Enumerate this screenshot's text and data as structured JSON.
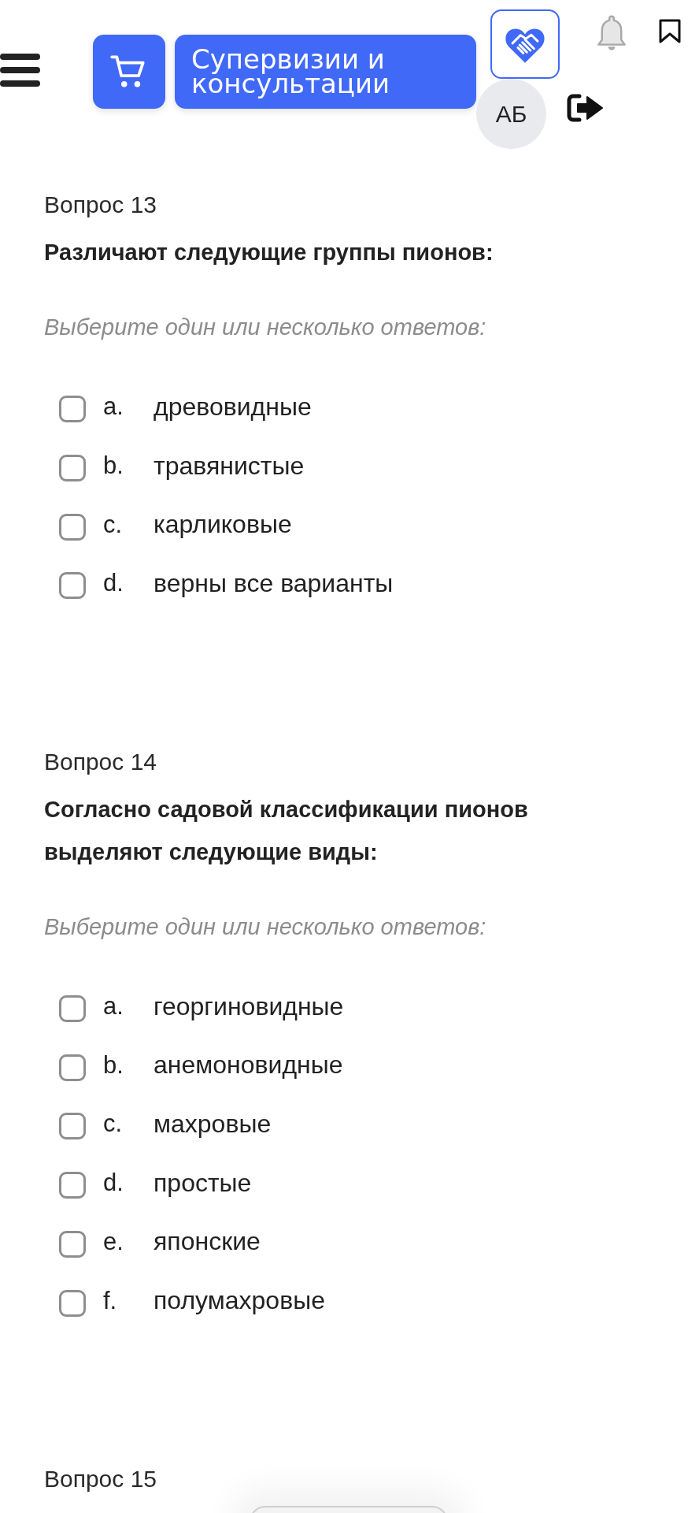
{
  "header": {
    "title_button": "Супервизии и консультации",
    "avatar_initials": "АБ"
  },
  "questions": [
    {
      "label": "Вопрос 13",
      "text": "Различают следующие группы пионов:",
      "hint": "Выберите один или несколько ответов:",
      "options": [
        {
          "letter": "a.",
          "text": "древовидные",
          "checked": false
        },
        {
          "letter": "b.",
          "text": "травянистые",
          "checked": false
        },
        {
          "letter": "c.",
          "text": "карликовые",
          "checked": false
        },
        {
          "letter": "d.",
          "text": "верны все варианты",
          "checked": false
        }
      ]
    },
    {
      "label": "Вопрос 14",
      "text": "Согласно садовой классификации пионов выделяют следующие виды:",
      "hint": "Выберите один или несколько ответов:",
      "options": [
        {
          "letter": "a.",
          "text": "георгиновидные",
          "checked": false
        },
        {
          "letter": "b.",
          "text": "анемоновидные",
          "checked": false
        },
        {
          "letter": "c.",
          "text": "махровые",
          "checked": false
        },
        {
          "letter": "d.",
          "text": "простые",
          "checked": false
        },
        {
          "letter": "e.",
          "text": "японские",
          "checked": false
        },
        {
          "letter": "f.",
          "text": "полумахровые",
          "checked": false
        }
      ]
    },
    {
      "label": "Вопрос 15"
    }
  ]
}
